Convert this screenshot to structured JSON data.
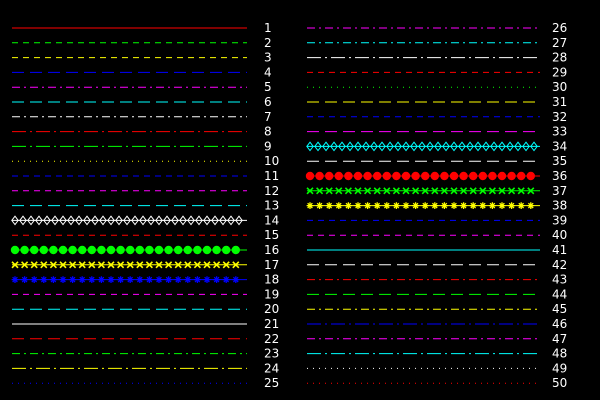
{
  "background": "#000000",
  "label_color": "#ffffff",
  "lines": [
    {
      "label": "1",
      "color": "#ff0000",
      "style": "solid",
      "marker": "none"
    },
    {
      "label": "2",
      "color": "#00ff00",
      "style": "dash",
      "marker": "none"
    },
    {
      "label": "3",
      "color": "#ffff00",
      "style": "dash",
      "marker": "none"
    },
    {
      "label": "4",
      "color": "#0000ff",
      "style": "long-dash",
      "marker": "none"
    },
    {
      "label": "5",
      "color": "#ff00ff",
      "style": "dash-dot",
      "marker": "none"
    },
    {
      "label": "6",
      "color": "#00ffff",
      "style": "long-dash",
      "marker": "none"
    },
    {
      "label": "7",
      "color": "#ffffff",
      "style": "dash-dot",
      "marker": "none"
    },
    {
      "label": "8",
      "color": "#ff0000",
      "style": "long-dash-dot",
      "marker": "none"
    },
    {
      "label": "9",
      "color": "#00ff00",
      "style": "long-dash-dot",
      "marker": "none"
    },
    {
      "label": "10",
      "color": "#ffff00",
      "style": "dotted",
      "marker": "none"
    },
    {
      "label": "11",
      "color": "#0000ff",
      "style": "dash",
      "marker": "none"
    },
    {
      "label": "12",
      "color": "#ff00ff",
      "style": "dash",
      "marker": "none"
    },
    {
      "label": "13",
      "color": "#00ffff",
      "style": "long-dash",
      "marker": "none"
    },
    {
      "label": "14",
      "color": "#ffffff",
      "style": "solid",
      "marker": "diamond"
    },
    {
      "label": "15",
      "color": "#ff0000",
      "style": "dash",
      "marker": "none"
    },
    {
      "label": "16",
      "color": "#00ff00",
      "style": "solid",
      "marker": "circle"
    },
    {
      "label": "17",
      "color": "#ffff00",
      "style": "solid",
      "marker": "x"
    },
    {
      "label": "18",
      "color": "#0000ff",
      "style": "solid",
      "marker": "star"
    },
    {
      "label": "19",
      "color": "#ff00ff",
      "style": "dash",
      "marker": "none"
    },
    {
      "label": "20",
      "color": "#00ffff",
      "style": "long-dash",
      "marker": "none"
    },
    {
      "label": "21",
      "color": "#ffffff",
      "style": "solid",
      "marker": "none"
    },
    {
      "label": "22",
      "color": "#ff0000",
      "style": "long-dash",
      "marker": "none"
    },
    {
      "label": "23",
      "color": "#00ff00",
      "style": "dash-dot",
      "marker": "none"
    },
    {
      "label": "24",
      "color": "#ffff00",
      "style": "long-dash-dot",
      "marker": "none"
    },
    {
      "label": "25",
      "color": "#0000ff",
      "style": "dotted",
      "marker": "none"
    },
    {
      "label": "26",
      "color": "#ff00ff",
      "style": "dash-dot",
      "marker": "none"
    },
    {
      "label": "27",
      "color": "#00ffff",
      "style": "dash-dot",
      "marker": "none"
    },
    {
      "label": "28",
      "color": "#ffffff",
      "style": "long-dash-dot",
      "marker": "none"
    },
    {
      "label": "29",
      "color": "#ff0000",
      "style": "dash",
      "marker": "none"
    },
    {
      "label": "30",
      "color": "#00ff00",
      "style": "dotted",
      "marker": "none"
    },
    {
      "label": "31",
      "color": "#ffff00",
      "style": "long-dash",
      "marker": "none"
    },
    {
      "label": "32",
      "color": "#0000ff",
      "style": "dash",
      "marker": "none"
    },
    {
      "label": "33",
      "color": "#ff00ff",
      "style": "long-dash",
      "marker": "none"
    },
    {
      "label": "34",
      "color": "#00ffff",
      "style": "solid",
      "marker": "diamond"
    },
    {
      "label": "35",
      "color": "#ffffff",
      "style": "long-dash",
      "marker": "none"
    },
    {
      "label": "36",
      "color": "#ff0000",
      "style": "solid",
      "marker": "circle"
    },
    {
      "label": "37",
      "color": "#00ff00",
      "style": "solid",
      "marker": "x"
    },
    {
      "label": "38",
      "color": "#ffff00",
      "style": "solid",
      "marker": "star"
    },
    {
      "label": "39",
      "color": "#0000ff",
      "style": "dash",
      "marker": "none"
    },
    {
      "label": "40",
      "color": "#ff00ff",
      "style": "dash",
      "marker": "none"
    },
    {
      "label": "41",
      "color": "#00ffff",
      "style": "solid",
      "marker": "none"
    },
    {
      "label": "42",
      "color": "#ffffff",
      "style": "long-dash",
      "marker": "none"
    },
    {
      "label": "43",
      "color": "#ff0000",
      "style": "dash-dot",
      "marker": "none"
    },
    {
      "label": "44",
      "color": "#00ff00",
      "style": "long-dash",
      "marker": "none"
    },
    {
      "label": "45",
      "color": "#ffff00",
      "style": "dash-dot",
      "marker": "none"
    },
    {
      "label": "46",
      "color": "#0000ff",
      "style": "long-dash-dot",
      "marker": "none"
    },
    {
      "label": "47",
      "color": "#ff00ff",
      "style": "dash-dot",
      "marker": "none"
    },
    {
      "label": "48",
      "color": "#00ffff",
      "style": "long-dash-dot",
      "marker": "none"
    },
    {
      "label": "49",
      "color": "#ffffff",
      "style": "dotted",
      "marker": "none"
    },
    {
      "label": "50",
      "color": "#ff0000",
      "style": "dotted",
      "marker": "none"
    }
  ]
}
